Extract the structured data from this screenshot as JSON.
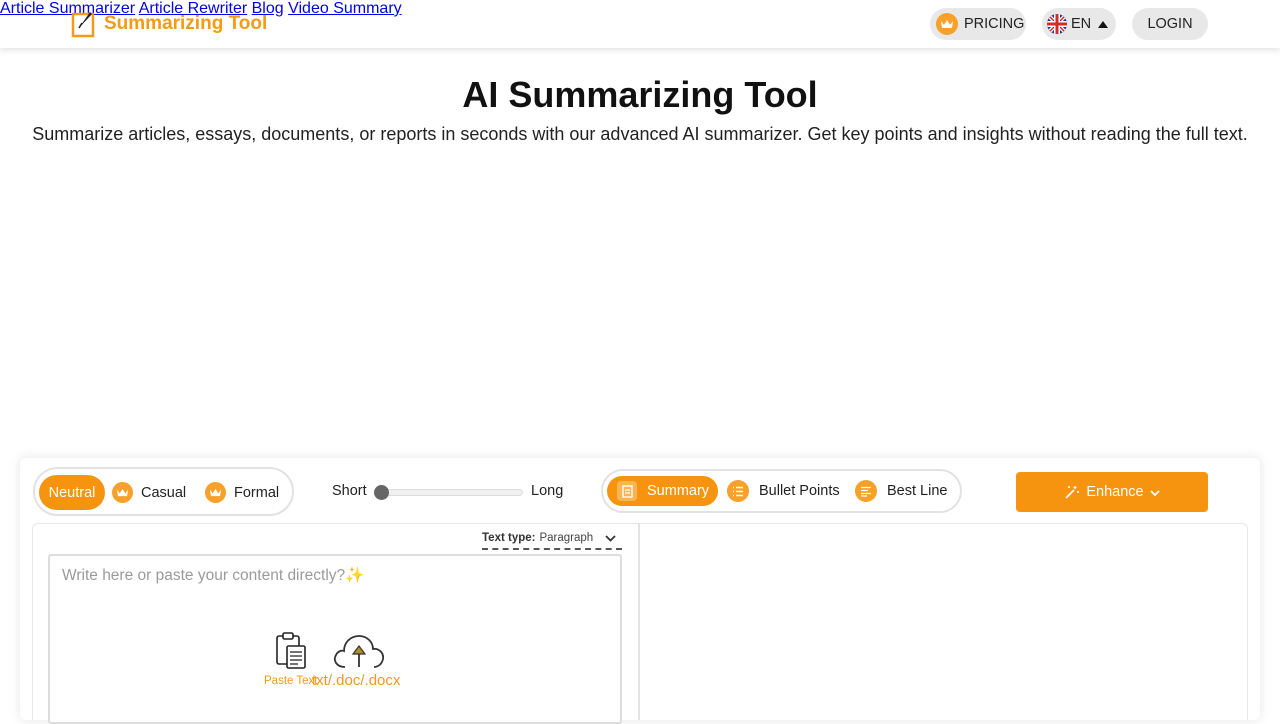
{
  "header": {
    "brand": "Summarizing Tool",
    "nav": [
      "Article Summarizer",
      "Article Rewriter",
      "Blog",
      "Video Summary"
    ],
    "pricing_label": "PRICING",
    "lang_label": "EN",
    "login_label": "LOGIN"
  },
  "hero": {
    "title": "AI Summarizing Tool",
    "subtitle": "Summarize articles, essays, documents, or reports in seconds with our advanced AI summarizer. Get key points and insights without reading the full text."
  },
  "toolbar": {
    "modes": [
      {
        "label": "Neutral",
        "active": true
      },
      {
        "label": "Casual",
        "active": false
      },
      {
        "label": "Formal",
        "active": false
      }
    ],
    "length": {
      "min_label": "Short",
      "max_label": "Long",
      "value": 0
    },
    "formats": [
      {
        "label": "Summary",
        "active": true
      },
      {
        "label": "Bullet Points",
        "active": false
      },
      {
        "label": "Best Line",
        "active": false
      }
    ],
    "enhance_label": "Enhance"
  },
  "editor": {
    "text_type_label": "Text type:",
    "text_type_value": "Paragraph",
    "placeholder": "Write here or paste your content directly?✨",
    "paste_label": "Paste Text",
    "upload_label": "txt/.doc/.docx"
  },
  "colors": {
    "accent": "#f7940f",
    "brand": "#f39a16"
  }
}
